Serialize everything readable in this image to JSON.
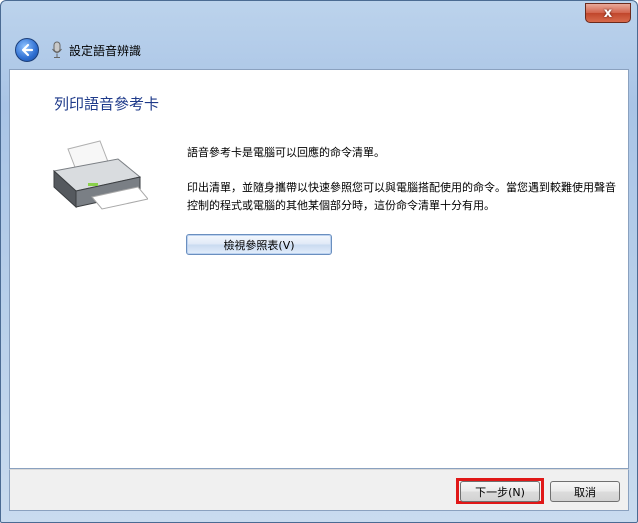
{
  "window": {
    "close_symbol": "x"
  },
  "header": {
    "title": "設定語音辨識",
    "back_icon": "back-arrow-icon",
    "mic_icon": "microphone-icon"
  },
  "content": {
    "heading": "列印語音參考卡",
    "printer_icon": "printer-icon",
    "paragraph1": "語音參考卡是電腦可以回應的命令清單。",
    "paragraph2": "印出清單，並隨身攜帶以快速參照您可以與電腦搭配使用的命令。當您遇到較難使用聲音控制的程式或電腦的其他某個部分時，這份命令清單十分有用。",
    "view_button_label": "檢視參照表(V)"
  },
  "footer": {
    "next_button_label": "下一步(N)",
    "cancel_button_label": "取消",
    "highlight_color": "#e01818"
  }
}
